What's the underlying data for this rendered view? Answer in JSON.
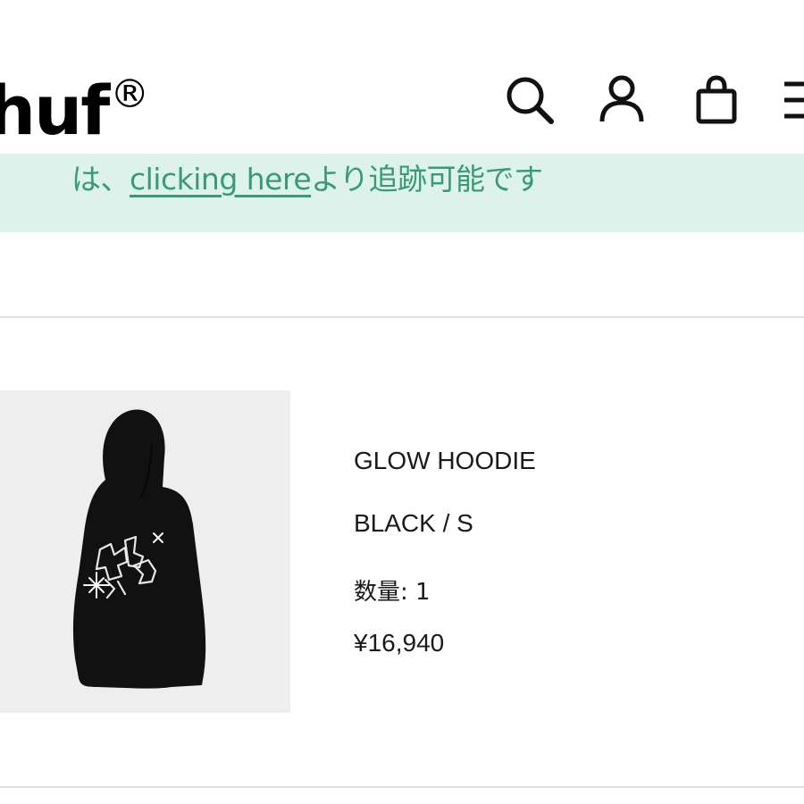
{
  "header": {
    "logo_text": "huf",
    "logo_mark": "®",
    "icons": [
      "search-icon",
      "account-icon",
      "cart-bag-icon",
      "menu-icon"
    ]
  },
  "banner": {
    "prefix": "は、",
    "link_text": "clicking here",
    "suffix": "より追跡可能です"
  },
  "item": {
    "name": "GLOW HOODIE",
    "variant": "BLACK / S",
    "quantity_label": "数量: 1",
    "price": "¥16,940"
  },
  "colors": {
    "banner_bg": "#dcf2ea",
    "banner_text": "#3b9a76",
    "divider": "#e0e0e0",
    "image_bg": "#eeeeee"
  }
}
